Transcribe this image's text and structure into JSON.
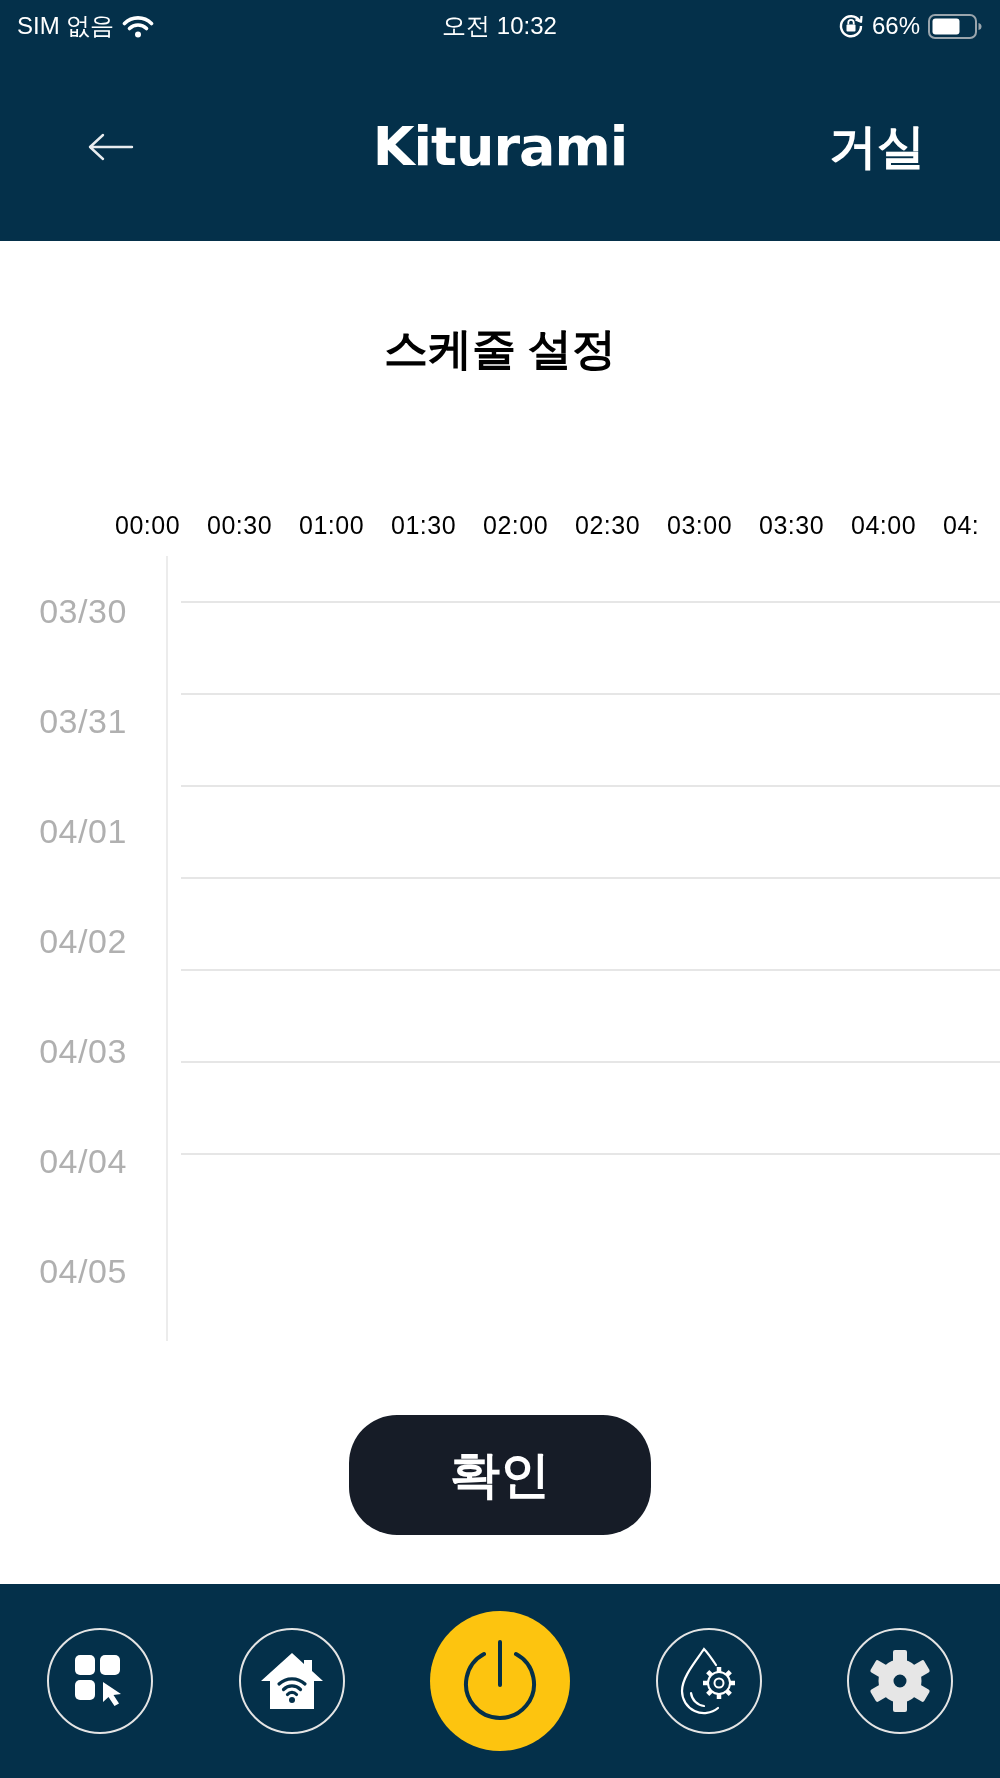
{
  "status_bar": {
    "carrier": "SIM 없음",
    "time": "오전 10:32",
    "battery": "66%"
  },
  "header": {
    "logo": "Kiturami",
    "room": "거실"
  },
  "heading": "스케줄 설정",
  "schedule": {
    "times": [
      "00:00",
      "00:30",
      "01:00",
      "01:30",
      "02:00",
      "02:30",
      "03:00",
      "03:30",
      "04:00",
      "04:"
    ],
    "dates": [
      "03/30",
      "03/31",
      "04/01",
      "04/02",
      "04/03",
      "04/04",
      "04/05"
    ]
  },
  "confirm_button": {
    "label": "확인"
  }
}
